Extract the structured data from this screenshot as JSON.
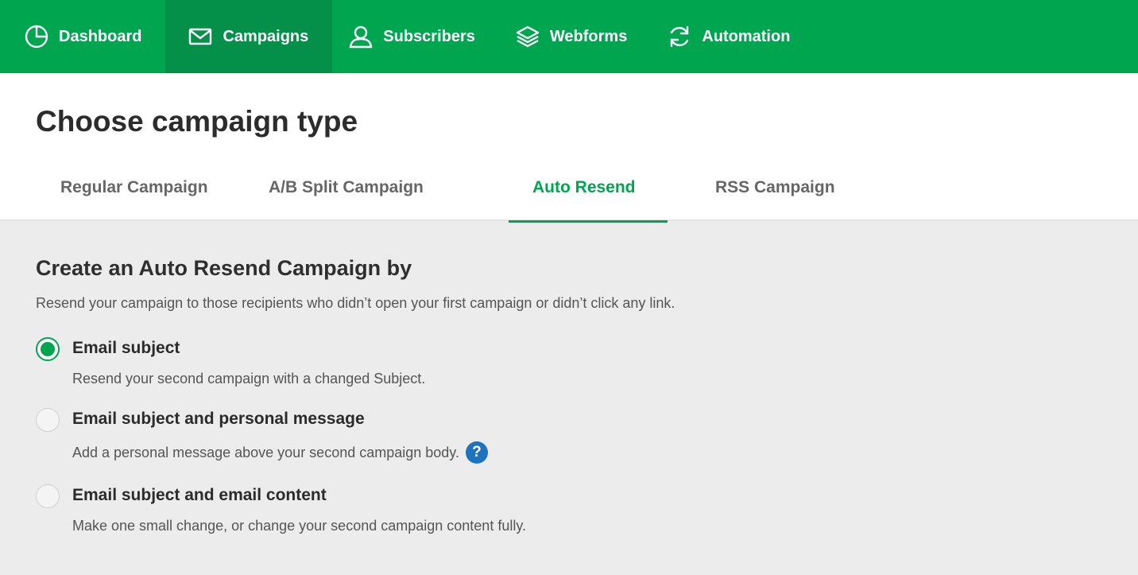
{
  "nav": {
    "items": [
      {
        "label": "Dashboard",
        "icon": "dashboard-icon"
      },
      {
        "label": "Campaigns",
        "icon": "envelope-icon",
        "active": true
      },
      {
        "label": "Subscribers",
        "icon": "user-icon"
      },
      {
        "label": "Webforms",
        "icon": "layers-icon"
      },
      {
        "label": "Automation",
        "icon": "refresh-icon"
      }
    ]
  },
  "page": {
    "title": "Choose campaign type"
  },
  "tabs": [
    {
      "label": "Regular Campaign"
    },
    {
      "label": "A/B Split Campaign"
    },
    {
      "label": "Auto Resend",
      "active": true
    },
    {
      "label": "RSS Campaign"
    }
  ],
  "section": {
    "title": "Create an Auto Resend Campaign by",
    "description": "Resend your campaign to those recipients who didn’t open your first campaign or didn’t click any link."
  },
  "options": [
    {
      "label": "Email subject",
      "description": "Resend your second campaign with a changed Subject.",
      "selected": true
    },
    {
      "label": "Email subject and personal message",
      "description": "Add a personal message above your second campaign body.",
      "selected": false,
      "help": "?"
    },
    {
      "label": "Email subject and email content",
      "description": "Make one small change, or change your second campaign content fully.",
      "selected": false
    }
  ],
  "colors": {
    "brand": "#00a550",
    "nav_active": "#05904a",
    "help": "#1e73be"
  }
}
